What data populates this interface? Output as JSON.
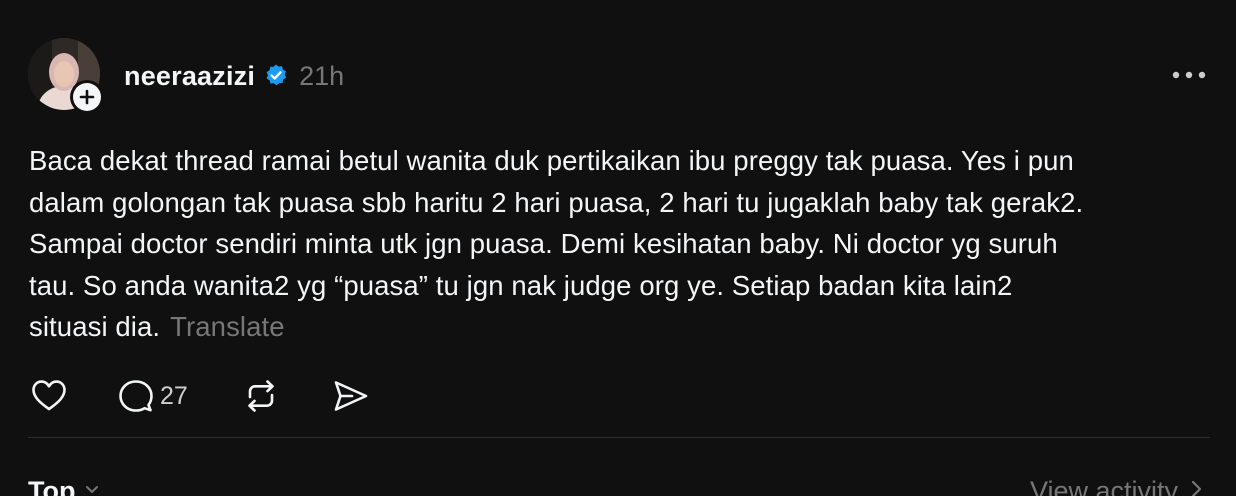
{
  "post": {
    "username": "neeraazizi",
    "timestamp": "21h",
    "lines": [
      "Baca dekat thread ramai betul wanita duk pertikaikan ibu preggy tak puasa. Yes i pun",
      "dalam golongan tak puasa sbb haritu 2 hari puasa, 2 hari tu jugaklah baby tak gerak2.",
      "Sampai doctor sendiri minta utk jgn puasa. Demi kesihatan baby. Ni doctor yg suruh",
      "tau. So anda wanita2 yg “puasa” tu jgn nak judge org ye. Setiap badan kita lain2",
      "situasi dia."
    ],
    "translate_label": "Translate",
    "reply_count": "27"
  },
  "footer": {
    "sort_label": "Top",
    "view_activity_label": "View activity"
  },
  "icons": {
    "avatar": "profile-photo",
    "follow": "plus-icon",
    "verified": "verified-badge-icon",
    "more": "more-horizontal-icon",
    "like": "heart-icon",
    "reply": "comment-icon",
    "repost": "repost-icon",
    "share": "send-icon",
    "sort_chevron": "chevron-down-icon",
    "view_chevron": "chevron-right-icon"
  },
  "colors": {
    "background": "#101010",
    "text": "#f3f5f7",
    "secondary": "#777777",
    "verified": "#1d9bf0"
  }
}
